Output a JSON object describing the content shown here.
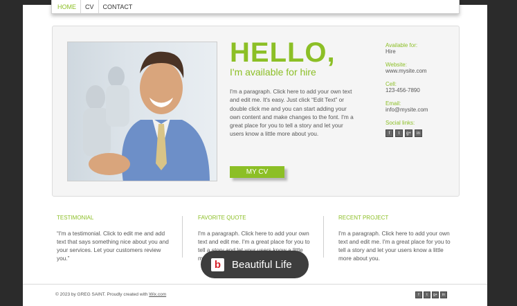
{
  "nav": {
    "items": [
      "HOME",
      "CV",
      "CONTACT"
    ]
  },
  "hero": {
    "headline": "HELLO,",
    "subheadline": "I'm available for hire",
    "about": "I'm a paragraph. Click here to add your own text and edit me. It's easy. Just click “Edit Text” or double click me and you can start adding your own content and make changes to the font. I'm a great place for you to tell a story and let your users know a little more about you.",
    "cv_button": "MY CV"
  },
  "contact": {
    "available_label": "Available for:",
    "available_value": "Hire",
    "website_label": "Website:",
    "website_value": "www.mysite.com",
    "cell_label": "Cell:",
    "cell_value": "123-456-7890",
    "email_label": "Email:",
    "email_value": "info@mysite.com",
    "social_label": "Social links:"
  },
  "columns": [
    {
      "title": "TESTIMONIAL",
      "text": "“I'm a testimonial. Click to edit me and add text that says something nice about you and your services. Let your customers review you.”"
    },
    {
      "title": "FAVORITE QUOTE",
      "text": "I'm a paragraph. Click here to add your own text and edit me. I'm a great place for you to tell a story and let your users know a little more about you."
    },
    {
      "title": "RECENT PROJECT",
      "text": "I'm a paragraph. Click here to add your own text and edit me. I'm a great place for you to tell a story and let your users know a little more about you."
    }
  ],
  "footer": {
    "copyright": "© 2023 by GREG SAINT. Proudly created with ",
    "link": "Wix.com"
  },
  "badge": {
    "logo": "b",
    "text": "Beautiful Life"
  },
  "social_icons": [
    "f",
    "t",
    "g+",
    "in"
  ],
  "colors": {
    "accent": "#8cbf26",
    "background": "#2b2b2b",
    "badge_bg": "#3d3d3d"
  }
}
